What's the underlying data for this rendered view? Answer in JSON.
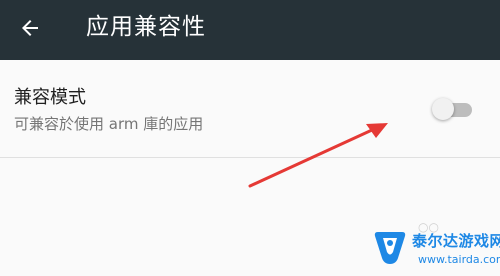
{
  "toolbar": {
    "title": "应用兼容性",
    "back_icon": "arrow-back-icon",
    "background_color": "#263238"
  },
  "preference": {
    "title": "兼容模式",
    "summary": "可兼容於使用 arm 庫的应用",
    "switch_state": "off"
  },
  "annotation": {
    "arrow_color": "#e53935"
  },
  "watermark": {
    "brand": "泰尔达游戏网",
    "url": "www.tairda.com",
    "color": "#1e88e5"
  }
}
